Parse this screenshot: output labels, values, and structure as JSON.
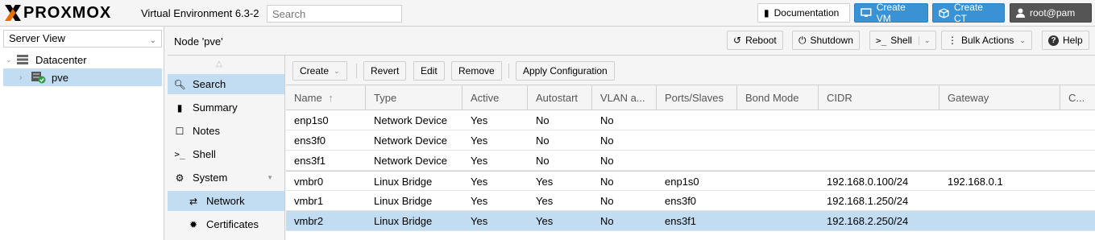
{
  "app": {
    "brand": "PROXMOX",
    "version": "Virtual Environment 6.3-2",
    "search_placeholder": "Search"
  },
  "topbar": {
    "documentation": "Documentation",
    "create_vm": "Create VM",
    "create_ct": "Create CT",
    "user": "root@pam"
  },
  "tree": {
    "view": "Server View",
    "datacenter": "Datacenter",
    "node": "pve"
  },
  "node_header": {
    "title": "Node 'pve'",
    "reboot": "Reboot",
    "shutdown": "Shutdown",
    "shell": "Shell",
    "bulk_actions": "Bulk Actions",
    "help": "Help"
  },
  "nav": {
    "search": "Search",
    "summary": "Summary",
    "notes": "Notes",
    "shell": "Shell",
    "system": "System",
    "network": "Network",
    "certificates": "Certificates"
  },
  "toolbar": {
    "create": "Create",
    "revert": "Revert",
    "edit": "Edit",
    "remove": "Remove",
    "apply": "Apply Configuration"
  },
  "grid": {
    "columns": [
      "Name",
      "Type",
      "Active",
      "Autostart",
      "VLAN a...",
      "Ports/Slaves",
      "Bond Mode",
      "CIDR",
      "Gateway",
      "C..."
    ],
    "rows": [
      [
        "enp1s0",
        "Network Device",
        "Yes",
        "No",
        "No",
        "",
        "",
        "",
        ""
      ],
      [
        "ens3f0",
        "Network Device",
        "Yes",
        "No",
        "No",
        "",
        "",
        "",
        ""
      ],
      [
        "ens3f1",
        "Network Device",
        "Yes",
        "No",
        "No",
        "",
        "",
        "",
        ""
      ],
      [
        "vmbr0",
        "Linux Bridge",
        "Yes",
        "Yes",
        "No",
        "enp1s0",
        "",
        "192.168.0.100/24",
        "192.168.0.1"
      ],
      [
        "vmbr1",
        "Linux Bridge",
        "Yes",
        "Yes",
        "No",
        "ens3f0",
        "",
        "192.168.1.250/24",
        ""
      ],
      [
        "vmbr2",
        "Linux Bridge",
        "Yes",
        "Yes",
        "No",
        "ens3f1",
        "",
        "192.168.2.250/24",
        ""
      ]
    ]
  },
  "colors": {
    "accent": "#3892d4",
    "selection": "#c2ddf2",
    "logo_orange": "#e57000"
  }
}
